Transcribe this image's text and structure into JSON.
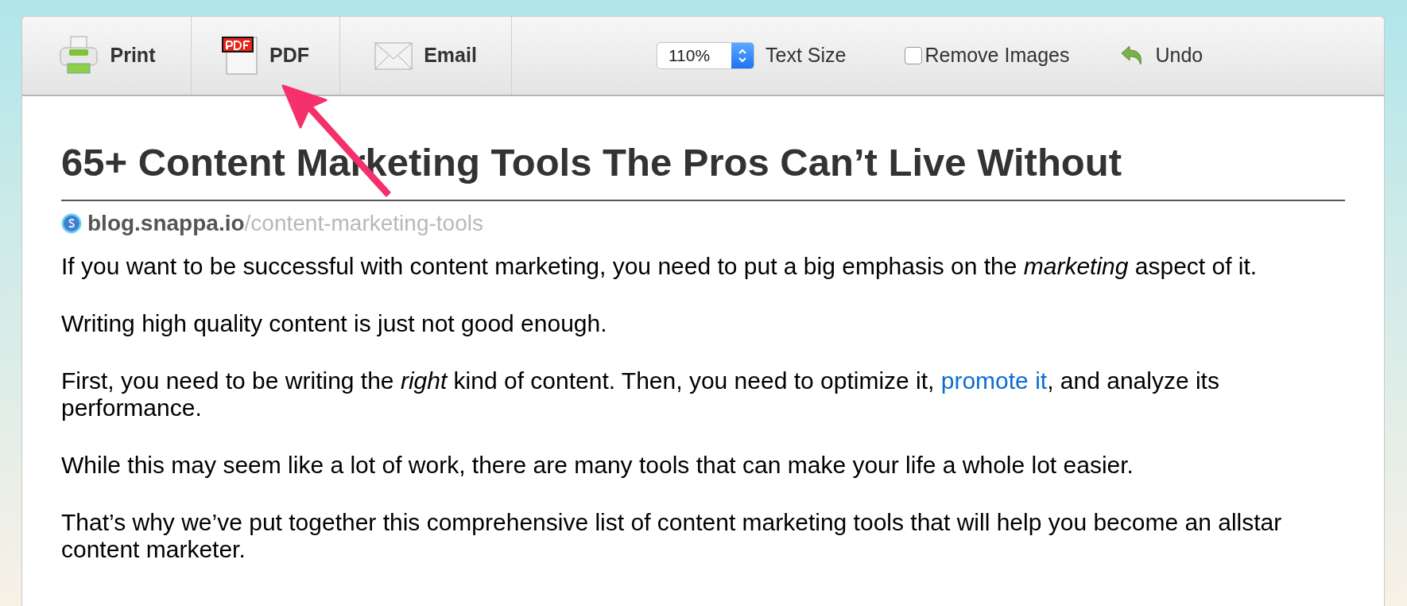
{
  "toolbar": {
    "buttons": [
      {
        "kind": "print",
        "label": "Print"
      },
      {
        "kind": "pdf",
        "label": "PDF"
      },
      {
        "kind": "email",
        "label": "Email"
      }
    ],
    "text_size": {
      "value": "110%",
      "label": "Text Size"
    },
    "remove_images": {
      "label": "Remove Images",
      "checked": false
    },
    "undo": {
      "label": "Undo"
    }
  },
  "article": {
    "title": "65+ Content Marketing Tools The Pros Can’t Live Without",
    "source": {
      "domain": "blog.snappa.io",
      "path": "/content-marketing-tools"
    },
    "paragraphs": [
      [
        {
          "kind": "text",
          "text": "If you want to be successful with content marketing, you need to put a big emphasis on the *marketing* aspect of it."
        }
      ],
      [
        {
          "kind": "text",
          "text": "Writing high quality content is just not good enough."
        }
      ],
      [
        {
          "kind": "text",
          "text": "First, you need to be writing the *right* kind of content. Then, you need to optimize it, "
        },
        {
          "kind": "link",
          "text": "promote it"
        },
        {
          "kind": "text",
          "text": ", and analyze its performance."
        }
      ],
      [
        {
          "kind": "text",
          "text": "While this may seem like a lot of work, there are many tools that can make your life a whole lot easier."
        }
      ],
      [
        {
          "kind": "text",
          "text": "That’s why we’ve put together this comprehensive list of content marketing tools that will help you become an allstar content marketer."
        }
      ]
    ]
  }
}
